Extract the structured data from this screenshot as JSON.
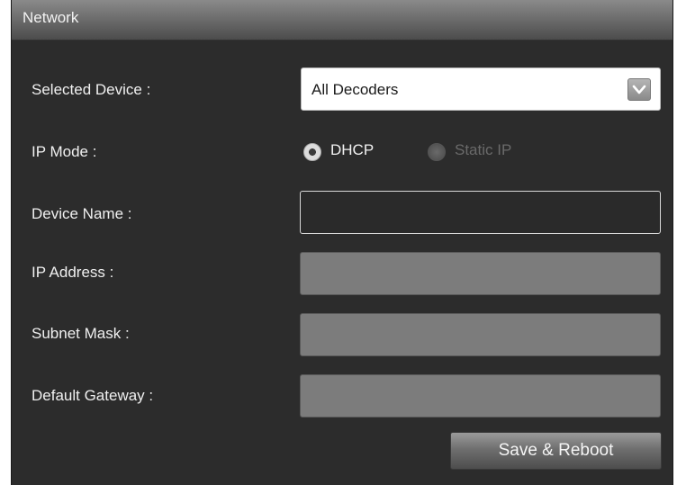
{
  "panel": {
    "title": "Network"
  },
  "labels": {
    "selected_device": "Selected Device :",
    "ip_mode": "IP Mode :",
    "device_name": "Device Name :",
    "ip_address": "IP Address :",
    "subnet_mask": "Subnet Mask :",
    "default_gateway": "Default Gateway :"
  },
  "selected_device": {
    "value": "All Decoders"
  },
  "ip_mode": {
    "options": [
      {
        "label": "DHCP",
        "selected": true,
        "enabled": true
      },
      {
        "label": "Static IP",
        "selected": false,
        "enabled": false
      }
    ]
  },
  "fields": {
    "device_name": "",
    "ip_address": "",
    "subnet_mask": "",
    "default_gateway": ""
  },
  "buttons": {
    "save_reboot": "Save & Reboot"
  },
  "colors": {
    "panel_bg": "#2c2c2c",
    "disabled_field": "#7c7c7c",
    "text": "#f0f0f0"
  },
  "icons": {
    "dropdown": "chevron-down-icon"
  }
}
